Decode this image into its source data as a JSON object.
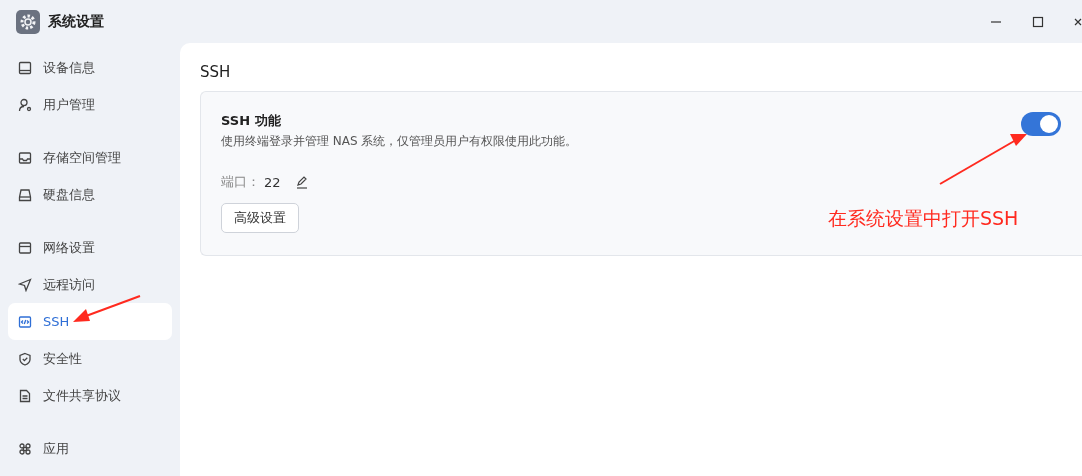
{
  "window": {
    "title": "系统设置"
  },
  "sidebar": {
    "groups": [
      {
        "items": [
          {
            "label": "设备信息",
            "kind": "device",
            "selected": false
          },
          {
            "label": "用户管理",
            "kind": "user",
            "selected": false
          }
        ]
      },
      {
        "items": [
          {
            "label": "存储空间管理",
            "kind": "storage",
            "selected": false
          },
          {
            "label": "硬盘信息",
            "kind": "disk",
            "selected": false
          }
        ]
      },
      {
        "items": [
          {
            "label": "网络设置",
            "kind": "network",
            "selected": false
          },
          {
            "label": "远程访问",
            "kind": "remote",
            "selected": false
          },
          {
            "label": "SSH",
            "kind": "code",
            "selected": true
          },
          {
            "label": "安全性",
            "kind": "shield",
            "selected": false
          },
          {
            "label": "文件共享协议",
            "kind": "file",
            "selected": false
          }
        ]
      },
      {
        "items": [
          {
            "label": "应用",
            "kind": "apps",
            "selected": false
          }
        ]
      }
    ]
  },
  "page": {
    "title": "SSH",
    "card": {
      "title": "SSH 功能",
      "description": "使用终端登录并管理 NAS 系统，仅管理员用户有权限使用此功能。",
      "on": true,
      "port_label": "端口：",
      "port": "22",
      "button": "高级设置"
    }
  },
  "annotations": [
    {
      "text": "在系统设置中打开SSH"
    }
  ]
}
